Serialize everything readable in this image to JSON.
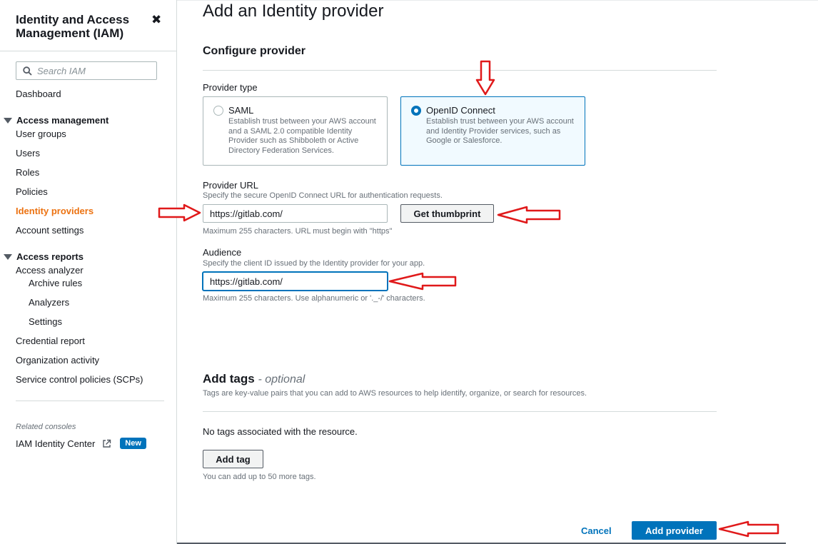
{
  "sidebar": {
    "title": "Identity and Access Management (IAM)",
    "close_symbol": "✖",
    "search_placeholder": "Search IAM",
    "dashboard": "Dashboard",
    "access_management": {
      "label": "Access management",
      "items": [
        "User groups",
        "Users",
        "Roles",
        "Policies",
        "Identity providers",
        "Account settings"
      ],
      "active": "Identity providers"
    },
    "access_reports": {
      "label": "Access reports",
      "analyzer": "Access analyzer",
      "analyzer_items": [
        "Archive rules",
        "Analyzers",
        "Settings"
      ],
      "items": [
        "Credential report",
        "Organization activity",
        "Service control policies (SCPs)"
      ]
    },
    "related_consoles": "Related consoles",
    "identity_center": "IAM Identity Center",
    "new_badge": "New"
  },
  "page": {
    "title": "Add an Identity provider",
    "configure_heading": "Configure provider",
    "provider_type_label": "Provider type",
    "provider_types": [
      {
        "title": "SAML",
        "description": "Establish trust between your AWS account and a SAML 2.0 compatible Identity Provider such as Shibboleth or Active Directory Federation Services.",
        "selected": false
      },
      {
        "title": "OpenID Connect",
        "description": "Establish trust between your AWS account and Identity Provider services, such as Google or Salesforce.",
        "selected": true
      }
    ],
    "provider_url": {
      "label": "Provider URL",
      "description": "Specify the secure OpenID Connect URL for authentication requests.",
      "value": "https://gitlab.com/",
      "hint": "Maximum 255 characters. URL must begin with \"https\""
    },
    "get_thumbprint": "Get thumbprint",
    "audience": {
      "label": "Audience",
      "description": "Specify the client ID issued by the Identity provider for your app.",
      "value": "https://gitlab.com/",
      "hint": "Maximum 255 characters. Use alphanumeric or '._-/' characters."
    },
    "tags": {
      "heading": "Add tags",
      "optional": "- optional",
      "description": "Tags are key-value pairs that you can add to AWS resources to help identify, organize, or search for resources.",
      "empty": "No tags associated with the resource.",
      "add_button": "Add tag",
      "limit": "You can add up to 50 more tags."
    },
    "cancel": "Cancel",
    "submit": "Add provider"
  },
  "colors": {
    "accent_orange": "#ec7211",
    "primary_blue": "#0073bb",
    "annotation_red": "#e0191a"
  }
}
